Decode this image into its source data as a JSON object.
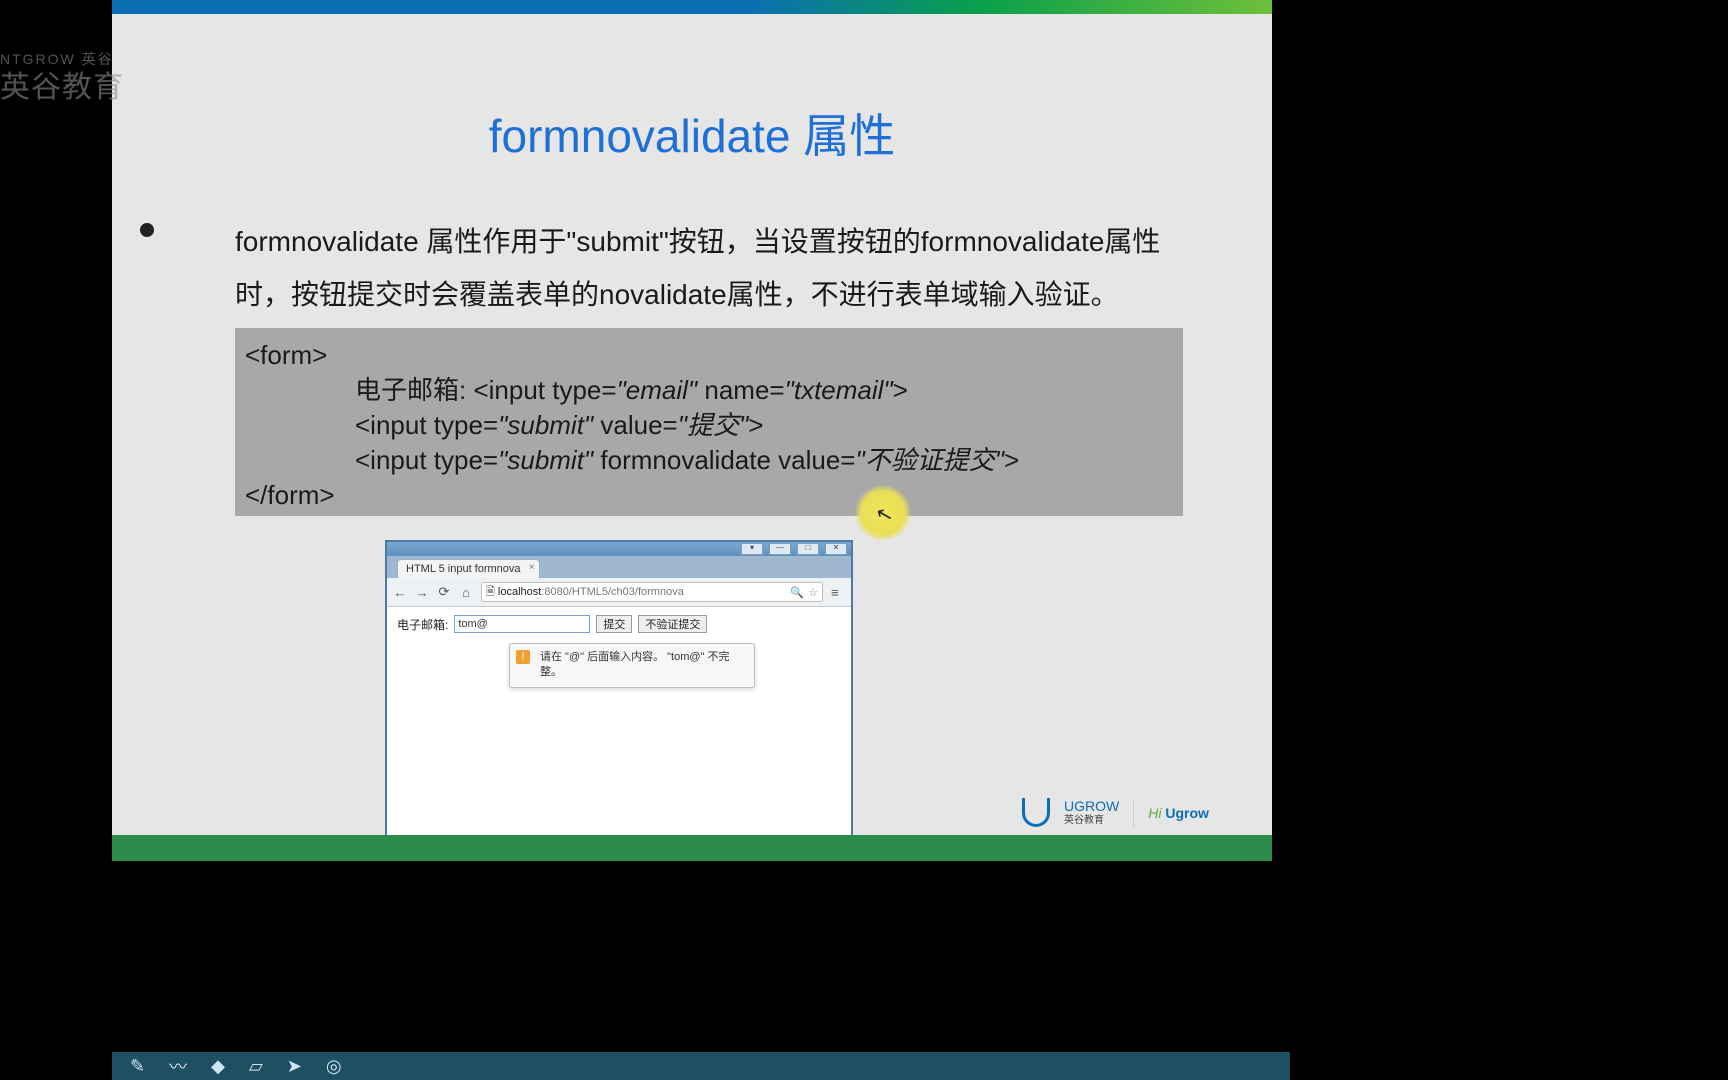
{
  "watermark": {
    "line1": "NTGROW 英谷",
    "line2": "英谷教育"
  },
  "slide": {
    "title": "formnovalidate 属性",
    "bullet": "formnovalidate 属性作用于\"submit\"按钮，当设置按钮的formnovalidate属性时，按钮提交时会覆盖表单的novalidate属性，不进行表单域输入验证。",
    "code": {
      "open": "<form>",
      "line1_pre": "电子邮箱: <input type=",
      "line1_em": "\"email\"",
      "line1_mid": " name=",
      "line1_em2": "\"txtemail\"",
      "line1_end": ">",
      "line2_pre": "<input    type=",
      "line2_em": "\"submit\"",
      "line2_mid": " value=",
      "line2_em2": "\"提交\"",
      "line2_end": ">",
      "line3_pre": "<input type=",
      "line3_em": "\"submit\"",
      "line3_mid": " formnovalidate  value=",
      "line3_em2": "\"不验证提交\"",
      "line3_end": ">",
      "close": "</form>"
    }
  },
  "browser": {
    "tab_title": "HTML 5 input formnova",
    "url_host": "localhost",
    "url_port_path": ":8080/HTML5/ch03/formnova",
    "form_label": "电子邮箱:",
    "input_value": "tom@",
    "submit_label": "提交",
    "novalidate_label": "不验证提交",
    "tooltip": "请在 \"@\" 后面输入内容。 \"tom@\" 不完整。"
  },
  "logos": {
    "brand": "UGROW",
    "brand_cn": "英谷教育",
    "hi_pre": "Hi ",
    "hi_brand": "Ugrow"
  },
  "tool_icons": {
    "pen": "✎",
    "wave": "〰",
    "tag": "◆",
    "erase": "▱",
    "arrow": "➤",
    "record": "◎"
  },
  "win_controls": {
    "min": "—",
    "max": "□",
    "close": "✕",
    "opts": "▾"
  }
}
